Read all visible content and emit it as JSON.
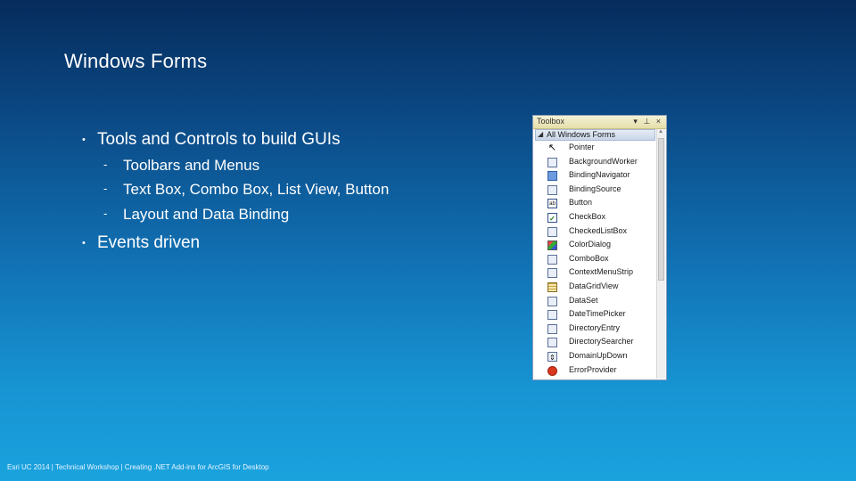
{
  "slide": {
    "title": "Windows Forms",
    "bullets": [
      {
        "text": "Tools and Controls to build GUIs",
        "subs": [
          "Toolbars and Menus",
          "Text Box, Combo Box, List View, Button",
          "Layout and Data Binding"
        ]
      },
      {
        "text": "Events driven",
        "subs": []
      }
    ],
    "bullet_marker": "•",
    "sub_marker": "-",
    "footer": "Esri UC 2014 | Technical Workshop | Creating .NET Add-ins for ArcGIS for Desktop"
  },
  "toolbox": {
    "title": "Toolbox",
    "controls_glyphs": "▾ ⊥ ×",
    "group_label": "All Windows Forms",
    "group_arrow": "◢",
    "items": [
      {
        "label": "Pointer",
        "icon": "pointer-icon",
        "glyph": "↖"
      },
      {
        "label": "BackgroundWorker",
        "icon": "background-worker-icon",
        "glyph": ""
      },
      {
        "label": "BindingNavigator",
        "icon": "binding-navigator-icon",
        "glyph": ""
      },
      {
        "label": "BindingSource",
        "icon": "binding-source-icon",
        "glyph": ""
      },
      {
        "label": "Button",
        "icon": "button-icon",
        "glyph": "ab"
      },
      {
        "label": "CheckBox",
        "icon": "checkbox-icon",
        "glyph": "✓"
      },
      {
        "label": "CheckedListBox",
        "icon": "checked-listbox-icon",
        "glyph": ""
      },
      {
        "label": "ColorDialog",
        "icon": "color-dialog-icon",
        "glyph": ""
      },
      {
        "label": "ComboBox",
        "icon": "combobox-icon",
        "glyph": ""
      },
      {
        "label": "ContextMenuStrip",
        "icon": "context-menu-strip-icon",
        "glyph": ""
      },
      {
        "label": "DataGridView",
        "icon": "data-grid-view-icon",
        "glyph": ""
      },
      {
        "label": "DataSet",
        "icon": "dataset-icon",
        "glyph": ""
      },
      {
        "label": "DateTimePicker",
        "icon": "date-time-picker-icon",
        "glyph": ""
      },
      {
        "label": "DirectoryEntry",
        "icon": "directory-entry-icon",
        "glyph": ""
      },
      {
        "label": "DirectorySearcher",
        "icon": "directory-searcher-icon",
        "glyph": ""
      },
      {
        "label": "DomainUpDown",
        "icon": "domain-updown-icon",
        "glyph": "⇕"
      },
      {
        "label": "ErrorProvider",
        "icon": "error-provider-icon",
        "glyph": ""
      }
    ]
  }
}
